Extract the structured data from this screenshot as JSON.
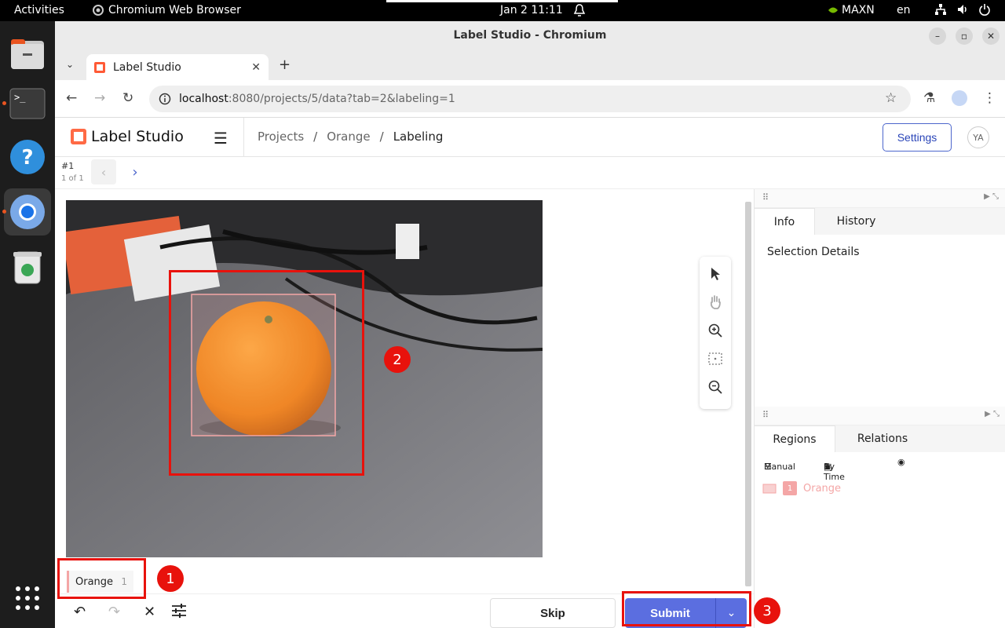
{
  "topbar": {
    "activities": "Activities",
    "app_name": "Chromium Web Browser",
    "clock": "Jan 2  11:11",
    "nvidia_mode": "MAXN",
    "lang": "en"
  },
  "window": {
    "title": "Label Studio - Chromium"
  },
  "browser": {
    "tab_title": "Label Studio",
    "url_host": "localhost",
    "url_path": ":8080/projects/5/data?tab=2&labeling=1"
  },
  "ls": {
    "brand": "Label Studio",
    "breadcrumbs": [
      "Projects",
      "Orange",
      "Labeling"
    ],
    "settings_label": "Settings",
    "avatar_initials": "YA",
    "task_id": "#1",
    "task_count": "1 of 1",
    "label_name": "Orange",
    "label_count": "1",
    "skip_label": "Skip",
    "submit_label": "Submit"
  },
  "sidepanel": {
    "tabs_top": [
      "Info",
      "History"
    ],
    "selection_details": "Selection Details",
    "tabs_bottom": [
      "Regions",
      "Relations"
    ],
    "manual_label": "Manual",
    "bytime_label": "By Time",
    "region_index": "1",
    "region_label": "Orange"
  },
  "markers": [
    "1",
    "2",
    "3"
  ],
  "colors": {
    "accent": "#5b6ee0",
    "label_orange": "#f4a6a6",
    "highlight": "#e8120c"
  }
}
